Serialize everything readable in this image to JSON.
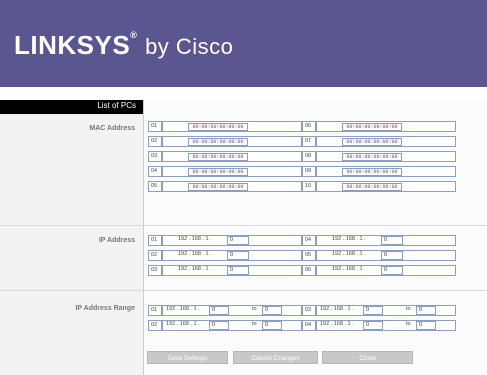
{
  "header": {
    "brand": "LINKSYS",
    "registered": "®",
    "sub": "by Cisco"
  },
  "sidebar": {
    "title": "List of PCs"
  },
  "mac_section": {
    "label": "MAC Address",
    "rows_left": [
      {
        "num": "01",
        "value": "00:00:00:00:00:00"
      },
      {
        "num": "02",
        "value": "00:00:00:00:00:00"
      },
      {
        "num": "03",
        "value": "00:00:00:00:00:00"
      },
      {
        "num": "04",
        "value": "00:00:00:00:00:00"
      },
      {
        "num": "05",
        "value": "00:00:00:00:00:00"
      }
    ],
    "rows_right": [
      {
        "num": "06",
        "value": "00:00:00:00:00:00"
      },
      {
        "num": "07",
        "value": "00:00:00:00:00:00"
      },
      {
        "num": "08",
        "value": "00:00:00:00:00:00"
      },
      {
        "num": "09",
        "value": "00:00:00:00:00:00"
      },
      {
        "num": "10",
        "value": "00:00:00:00:00:00"
      }
    ]
  },
  "ip_section": {
    "label": "IP Address",
    "rows_left": [
      {
        "num": "01",
        "prefix": "192 . 168 . 1 .",
        "value": "0"
      },
      {
        "num": "02",
        "prefix": "192 . 168 . 1 .",
        "value": "0"
      },
      {
        "num": "03",
        "prefix": "192 . 168 . 1 .",
        "value": "0"
      }
    ],
    "rows_right": [
      {
        "num": "04",
        "prefix": "192 . 168 . 1 .",
        "value": "0"
      },
      {
        "num": "05",
        "prefix": "192 . 168 . 1 .",
        "value": "0"
      },
      {
        "num": "06",
        "prefix": "192 . 168 . 1 .",
        "value": "0"
      }
    ]
  },
  "range_section": {
    "label": "IP Address Range",
    "to_label": "to",
    "rows_left": [
      {
        "num": "01",
        "prefix": "192 . 168 . 1 .",
        "from": "0",
        "to": "0"
      },
      {
        "num": "02",
        "prefix": "192 . 168 . 1 .",
        "from": "0",
        "to": "0"
      }
    ],
    "rows_right": [
      {
        "num": "03",
        "prefix": "192 . 168 . 1 .",
        "from": "0",
        "to": "0"
      },
      {
        "num": "04",
        "prefix": "192 . 168 . 1 .",
        "from": "0",
        "to": "0"
      }
    ]
  },
  "buttons": {
    "save": "Save Settings",
    "cancel": "Cancel Changes",
    "close": "Close"
  }
}
